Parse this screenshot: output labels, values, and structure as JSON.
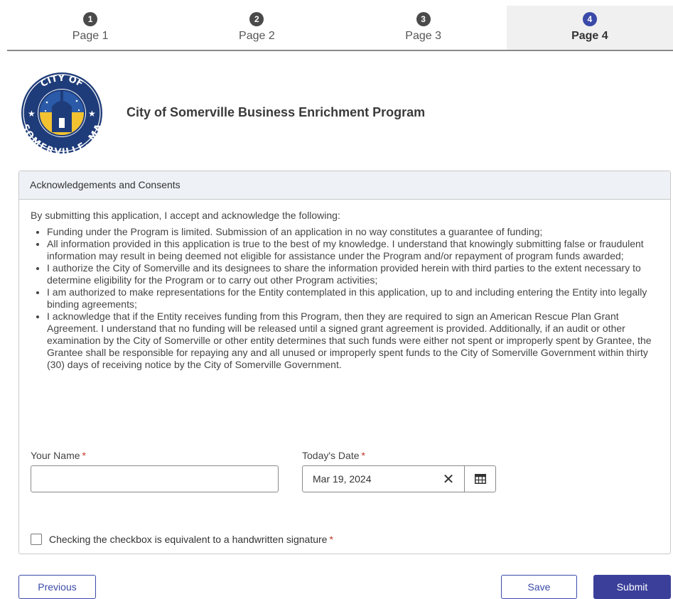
{
  "stepper": {
    "steps": [
      {
        "num": "1",
        "label": "Page 1"
      },
      {
        "num": "2",
        "label": "Page 2"
      },
      {
        "num": "3",
        "label": "Page 3"
      },
      {
        "num": "4",
        "label": "Page 4"
      }
    ],
    "active_index": 3
  },
  "header": {
    "seal_top_text": "CITY OF",
    "seal_bottom_text": "SOMERVILLE, MA",
    "title": "City of Somerville Business Enrichment Program"
  },
  "panel": {
    "title": "Acknowledgements and Consents",
    "intro": "By submitting this application, I accept and acknowledge the following:",
    "items": [
      "Funding under the Program is limited. Submission of an application in no way constitutes a guarantee of funding;",
      "All information provided in this application is true to the best of my knowledge. I understand that knowingly submitting false or fraudulent information may result in being deemed not eligible for assistance under the Program and/or repayment of program funds awarded;",
      "I authorize the City of Somerville and its designees to share the information provided herein with third parties to the extent necessary to determine eligibility for the Program or to carry out other Program activities;",
      "I am authorized to make representations for the Entity contemplated in this application, up to and including entering the Entity into legally binding agreements;",
      "I acknowledge that if the Entity receives funding from this Program, then they are required to sign an American Rescue Plan Grant Agreement.  I understand that no funding will be released until a signed grant agreement is provided.  Additionally, if an audit or other examination by the City of Somerville or other entity determines that such funds were either not spent or improperly spent by Grantee, the Grantee shall be responsible for repaying any and all unused or improperly spent funds to the City of Somerville Government within thirty (30) days of receiving notice by the City of Somerville Government."
    ]
  },
  "form": {
    "name_label": "Your Name",
    "name_value": "",
    "date_label": "Today's Date",
    "date_value": "Mar 19, 2024",
    "date_clear_glyph": "✕",
    "required_marker": "*",
    "signature_label": "Checking the checkbox is equivalent to a handwritten signature",
    "signature_checked": false
  },
  "footer": {
    "previous_label": "Previous",
    "save_label": "Save",
    "submit_label": "Submit"
  },
  "colors": {
    "accent": "#3b4aa8",
    "primary_button": "#3b3f9a",
    "required": "#c0392b",
    "panel_header_bg": "#eef1f6",
    "seal_navy": "#1f3c7a",
    "seal_gold": "#f2c230"
  },
  "icons": {
    "clear": "close-icon",
    "calendar": "calendar-icon",
    "seal": "city-seal-logo"
  }
}
